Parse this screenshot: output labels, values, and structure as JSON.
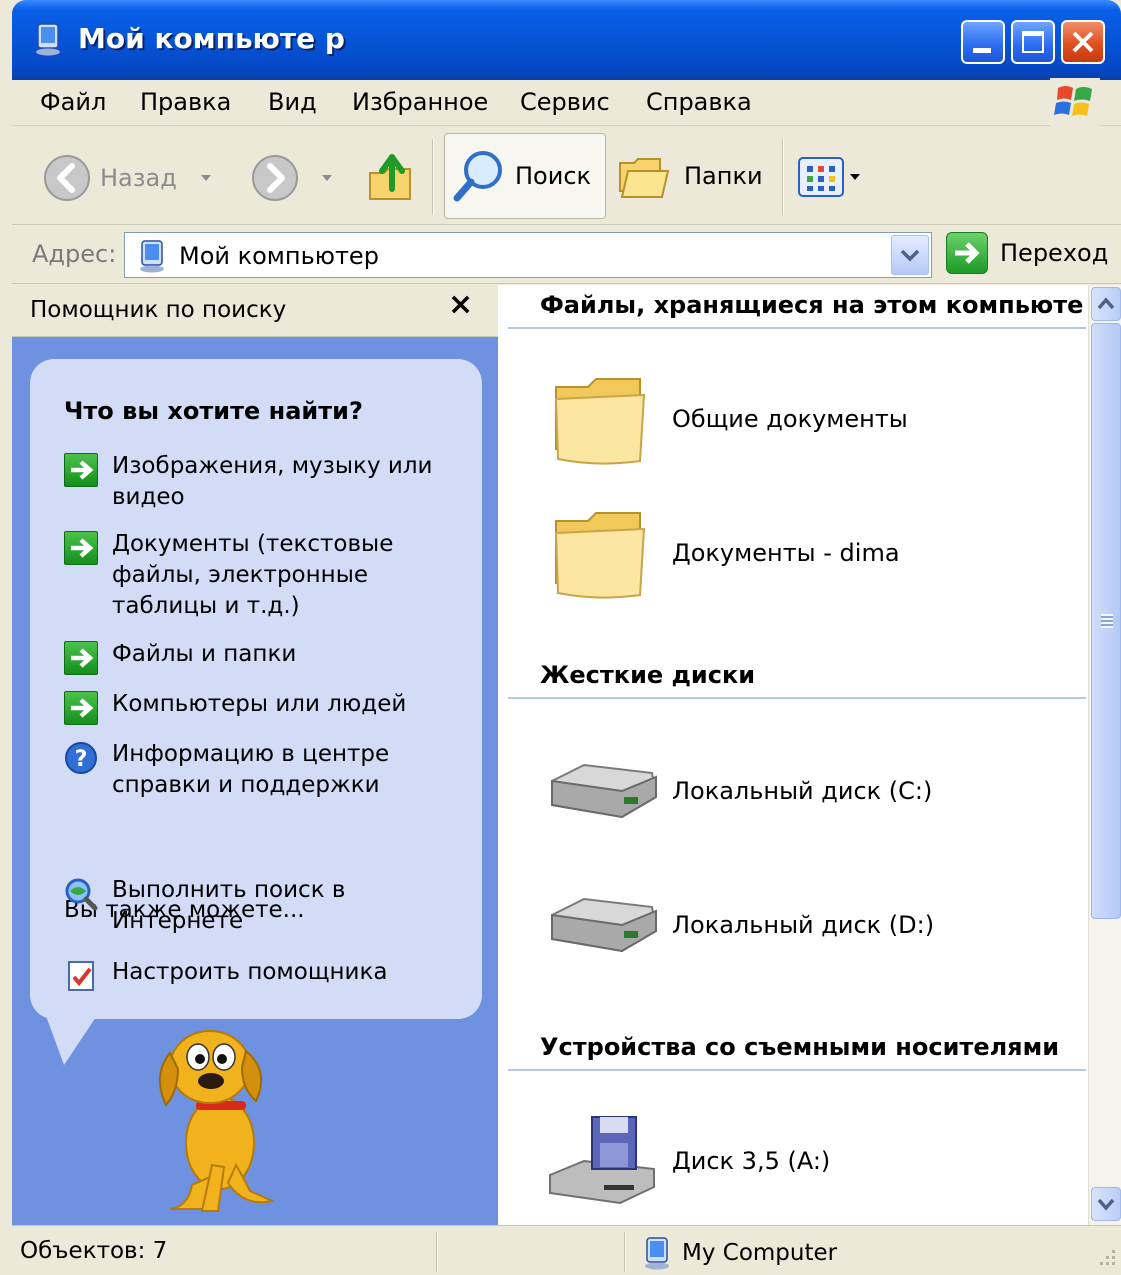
{
  "window": {
    "title": "Мой компьюте р",
    "icon": "my-computer-icon"
  },
  "menu": {
    "items": [
      "Файл",
      "Правка",
      "Вид",
      "Избранное",
      "Сервис",
      "Справка"
    ]
  },
  "toolbar": {
    "back_label": "Назад",
    "search_label": "Поиск",
    "folders_label": "Папки"
  },
  "address": {
    "label": "Адрес:",
    "value": "Мой компьютер",
    "go_label": "Переход"
  },
  "search_pane": {
    "title": "Помощник по поиску",
    "close_glyph": "×",
    "heading": "Что вы хотите найти?",
    "options": [
      {
        "text": "Изображения, музыку или видео",
        "icon": "green-arrow-icon"
      },
      {
        "text": "Документы (текстовые файлы, электронные таблицы и т.д.)",
        "icon": "green-arrow-icon"
      },
      {
        "text": "Файлы и папки",
        "icon": "green-arrow-icon"
      },
      {
        "text": "Компьютеры или людей",
        "icon": "green-arrow-icon"
      },
      {
        "text": "Информацию в центре справки и поддержки",
        "icon": "help-icon"
      }
    ],
    "also_label": "Вы также можете...",
    "extra_options": [
      {
        "text": "Выполнить поиск в Интернете",
        "icon": "internet-search-icon"
      },
      {
        "text": "Настроить помощника",
        "icon": "checklist-icon"
      }
    ]
  },
  "files": {
    "groups": [
      {
        "title": "Файлы, хранящиеся на этом компьюте",
        "items": [
          "Общие документы",
          "Документы - dima"
        ]
      },
      {
        "title": "Жесткие диски",
        "items": [
          "Локальный диск (C:)",
          "Локальный диск (D:)"
        ]
      },
      {
        "title": "Устройства со съемными носителями",
        "items": [
          "Диск 3,5 (A:)"
        ]
      }
    ]
  },
  "status": {
    "objects": "Объектов: 7",
    "location": "My Computer"
  },
  "colors": {
    "titlebar": "#0653d6",
    "chrome": "#ece9d8",
    "pane": "#6f92e0",
    "bubble": "#d3dcf7",
    "accent_green": "#1f9a28"
  }
}
